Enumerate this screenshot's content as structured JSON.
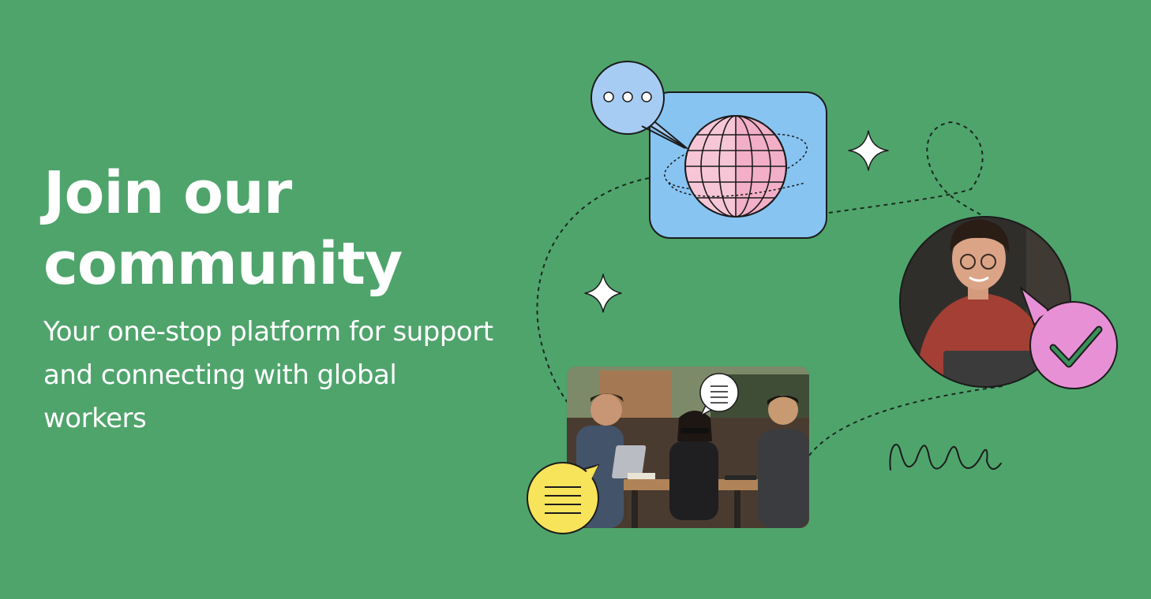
{
  "hero": {
    "headline": "Join our community",
    "subline": "Your one-stop platform for support and connecting with global workers"
  },
  "colors": {
    "background": "#4fa46c",
    "globe_tile": "#88c4f2",
    "globe": "#f3afc7",
    "speech_blue": "#a7ccf4",
    "speech_yellow": "#f7e45a",
    "speech_pink": "#e890d6",
    "check": "#3a8f5a",
    "outline": "#1b1b1b",
    "text": "#ffffff"
  },
  "icons": [
    "speech-bubble-dots-icon",
    "globe-icon",
    "sparkle-icon",
    "speech-bubble-lines-icon",
    "checkmark-icon",
    "scribble-icon"
  ]
}
